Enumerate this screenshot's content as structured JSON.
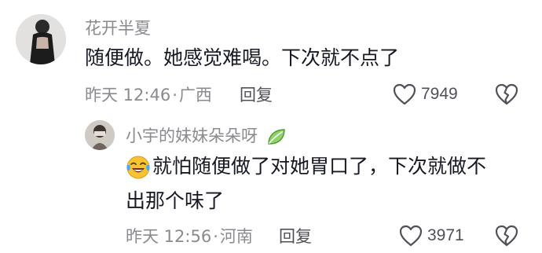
{
  "comments": [
    {
      "username": "花开半夏",
      "text": "随便做。她感觉难喝。下次就不点了",
      "time": "昨天 12:46",
      "location": "广西",
      "reply_label": "回复",
      "like_count": "7949"
    }
  ],
  "replies": [
    {
      "username": "小宇的妹妹朵朵呀",
      "badge_icon": "leaf-icon",
      "emoji_icon": "laugh-cry-icon",
      "text_line1": "就怕随便做了对她胃口了，下次就做不",
      "text_line2": "出那个味了",
      "time": "昨天 12:56",
      "location": "河南",
      "reply_label": "回复",
      "like_count": "3971"
    }
  ],
  "meta_separator": "·",
  "colors": {
    "text_primary": "#161823",
    "text_secondary": "#8a8a8f",
    "icon": "#505058",
    "emoji": "#f7b731",
    "leaf": "#6cc04a"
  }
}
